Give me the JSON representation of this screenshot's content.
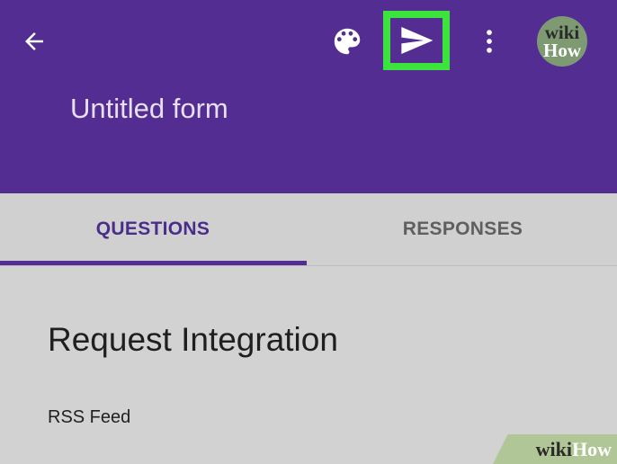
{
  "appbar": {
    "color": "#532d91",
    "back_icon": "arrow-left-icon",
    "palette_icon": "palette-icon",
    "send_icon": "send-icon",
    "highlight_color": "#3ce33c",
    "more_icon": "more-vertical-icon",
    "avatar": {
      "line1": "wiki",
      "line2": "How"
    },
    "title": "Untitled form"
  },
  "tabs": [
    {
      "label": "QUESTIONS",
      "active": true
    },
    {
      "label": "RESPONSES",
      "active": false
    }
  ],
  "form": {
    "heading": "Request Integration",
    "description": "RSS Feed"
  },
  "watermark": {
    "part1": "wiki",
    "part2": "How"
  }
}
